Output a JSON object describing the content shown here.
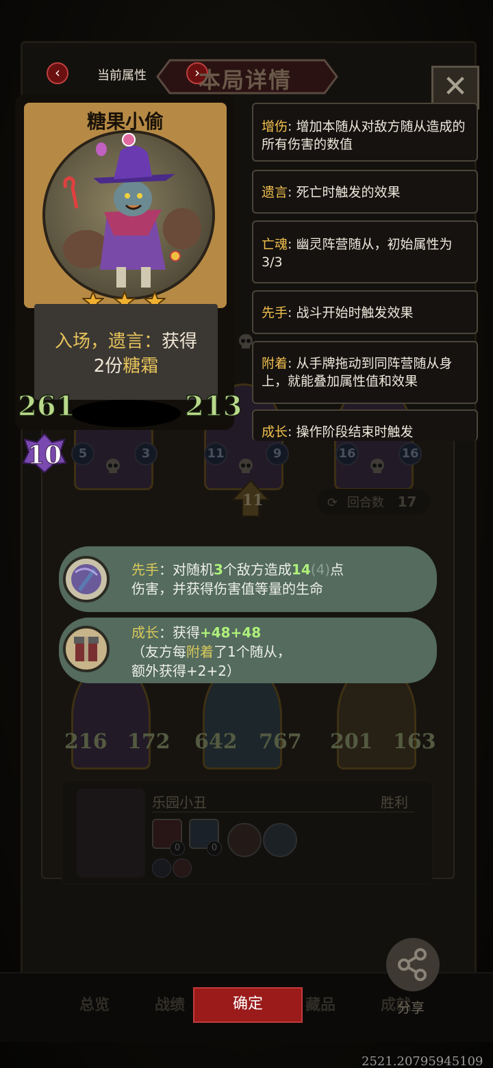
{
  "header": {
    "current_tab": "当前属性",
    "title": "本局详情"
  },
  "card": {
    "name": "糖果小偷",
    "stars": 3,
    "desc": {
      "line1_a": "入场，遗言：",
      "line1_b": "获得",
      "line2_a": "2份",
      "line2_b": "糖霜"
    },
    "attack": "261",
    "health": "213",
    "level": "10"
  },
  "keywords": [
    {
      "name": "增伤",
      "text": ": 增加本随从对敌方随从造成的所有伤害的数值"
    },
    {
      "name": "遗言",
      "text": ": 死亡时触发的效果"
    },
    {
      "name": "亡魂",
      "text": ": 幽灵阵营随从，初始属性为3/3"
    },
    {
      "name": "先手",
      "text": ": 战斗开始时触发效果"
    },
    {
      "name": "附着",
      "text": ": 从手牌拖动到同阵营随从身上，就能叠加属性值和效果"
    },
    {
      "name": "成长",
      "text": ": 操作阶段结束时触发"
    }
  ],
  "skills": [
    {
      "tag": "先手",
      "a": "：对随机",
      "num1": "3",
      "b": "个敌方造成",
      "num2": "14",
      "paren": "(4)",
      "c": "点",
      "line2": "伤害，并获得伤害值等量的生命"
    },
    {
      "tag": "成长",
      "a": "：获得",
      "num1": "+48",
      "num2": "+48",
      "line2_a": "（友方每",
      "line2_hl": "附着",
      "line2_b": "了1个随从，",
      "line3_a": "额外获得",
      "line3_num": "+2+2",
      "line3_b": "）"
    }
  ],
  "background": {
    "team_row1": [
      {
        "left": "5",
        "right": "3"
      },
      {
        "left": "11",
        "right": "9"
      },
      {
        "left": "16",
        "right": "16"
      }
    ],
    "turn_badge": "11",
    "round_label": "回合数",
    "round_count": "17",
    "team_row2": [
      {
        "attack": "216",
        "health": "172"
      },
      {
        "attack": "642",
        "health": "767"
      },
      {
        "attack": "201",
        "health": "163"
      }
    ],
    "opponent": {
      "name": "乐园小丑",
      "result": "胜利",
      "counts": [
        "0",
        "0"
      ]
    }
  },
  "tabs": [
    "总览",
    "战绩",
    "藏品",
    "成就"
  ],
  "footer": {
    "confirm": "确定",
    "share": "分享",
    "version": "2521.20795945109"
  },
  "colors": {
    "keyword": "#f2c04e",
    "stat_green": "#b9d98a",
    "confirm_red": "#9b1b1b",
    "bubble_bg": "#546b5e"
  }
}
